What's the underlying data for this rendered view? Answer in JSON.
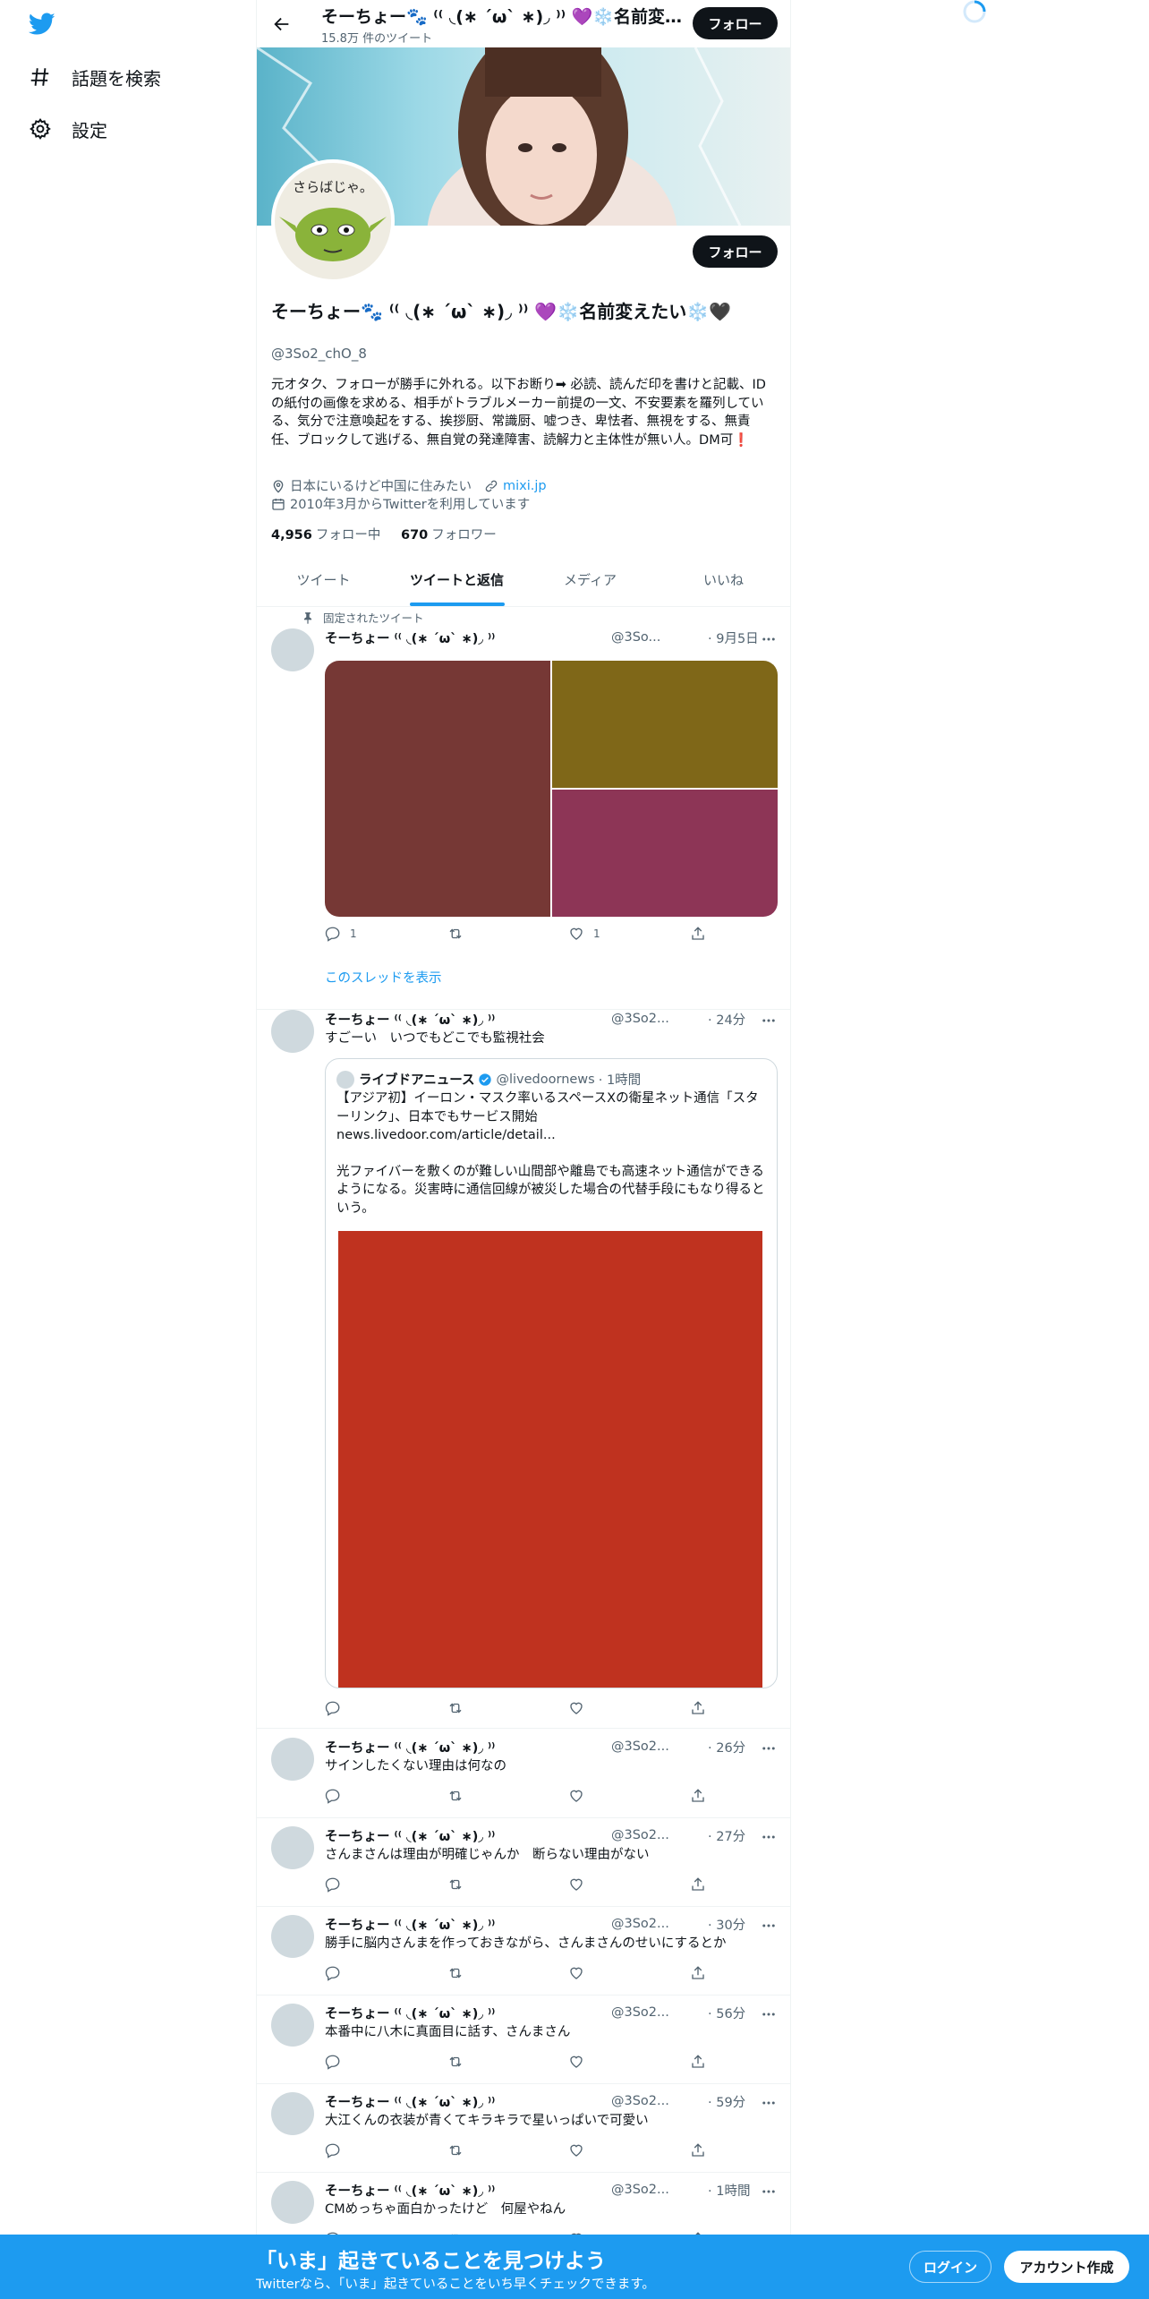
{
  "nav": {
    "items": [
      {
        "label": "話題を検索",
        "icon": "hashtag-icon"
      },
      {
        "label": "設定",
        "icon": "gear-icon"
      }
    ]
  },
  "header": {
    "name": "そーちょー🐾 ⁽⁽ ◟(∗ ˊωˋ ∗)◞ ⁾⁾ 💜❄️名前変えたい❄️🖤",
    "tweet_count": "15.8万 件のツイート",
    "follow_label": "フォロー"
  },
  "profile": {
    "name": "そーちょー🐾 ⁽⁽ ◟(∗ ˊωˋ ∗)◞ ⁾⁾ 💜❄️名前変えたい❄️🖤",
    "handle": "@3So2_chO_8",
    "follow_label": "フォロー",
    "avatar_text": "さらばじゃ。",
    "bio": "元オタク、フォローが勝手に外れる。以下お断り➡ 必読、読んだ印を書けと記載、IDの紙付の画像を求める、相手がトラブルメーカー前提の一文、不安要素を羅列している、気分で注意喚起をする、挨拶厨、常識厨、嘘つき、卑怯者、無視をする、無責任、ブロックして逃げる、無自覚の発達障害、読解力と主体性が無い人。DM可❗",
    "location": "日本にいるけど中国に住みたい",
    "link": "mixi.jp",
    "joined": "2010年3月からTwitterを利用しています",
    "following_count": "4,956",
    "following_label": "フォロー中",
    "followers_count": "670",
    "followers_label": "フォロワー"
  },
  "tabs": [
    {
      "label": "ツイート",
      "active": false
    },
    {
      "label": "ツイートと返信",
      "active": true
    },
    {
      "label": "メディア",
      "active": false
    },
    {
      "label": "いいね",
      "active": false
    }
  ],
  "pinned_label": "固定されたツイート",
  "show_thread": "このスレッドを表示",
  "tweets": [
    {
      "name": "そーちょー ⁽⁽ ◟(∗ ˊωˋ ∗)◞ ⁾⁾",
      "handle": "@3So...",
      "time": "· 9月5日",
      "text": "",
      "reply_count": "1",
      "like_count": "1",
      "media_colors": [
        "#763835",
        "#7f6718",
        "#8d3556"
      ]
    },
    {
      "name": "そーちょー ⁽⁽ ◟(∗ ˊωˋ ∗)◞ ⁾⁾",
      "handle": "@3So2...",
      "time": "· 24分",
      "text": "すごーい　いつでもどこでも監視社会"
    },
    {
      "name": "そーちょー ⁽⁽ ◟(∗ ˊωˋ ∗)◞ ⁾⁾",
      "handle": "@3So2...",
      "time": "· 26分",
      "text": "サインしたくない理由は何なの"
    },
    {
      "name": "そーちょー ⁽⁽ ◟(∗ ˊωˋ ∗)◞ ⁾⁾",
      "handle": "@3So2...",
      "time": "· 27分",
      "text": "さんまさんは理由が明確じゃんか　断らない理由がない"
    },
    {
      "name": "そーちょー ⁽⁽ ◟(∗ ˊωˋ ∗)◞ ⁾⁾",
      "handle": "@3So2...",
      "time": "· 30分",
      "text": "勝手に脳内さんまを作っておきながら、さんまさんのせいにするとか"
    },
    {
      "name": "そーちょー ⁽⁽ ◟(∗ ˊωˋ ∗)◞ ⁾⁾",
      "handle": "@3So2...",
      "time": "· 56分",
      "text": "本番中に八木に真面目に話す、さんまさん"
    },
    {
      "name": "そーちょー ⁽⁽ ◟(∗ ˊωˋ ∗)◞ ⁾⁾",
      "handle": "@3So2...",
      "time": "· 59分",
      "text": "大江くんの衣装が青くてキラキラで星いっぱいで可愛い"
    },
    {
      "name": "そーちょー ⁽⁽ ◟(∗ ˊωˋ ∗)◞ ⁾⁾",
      "handle": "@3So2...",
      "time": "· 1時間",
      "text": "CMめっちゃ面白かったけど　何屋やねん"
    }
  ],
  "quote": {
    "name": "ライブドアニュース",
    "handle": "@livedoornews",
    "time": "· 1時間",
    "line1": "【アジア初】イーロン・マスク率いるスペースXの衛星ネット通信「スターリンク」、日本でもサービス開始",
    "line2": "news.livedoor.com/article/detail...",
    "line3": "光ファイバーを敷くのが難しい山間部や離島でも高速ネット通信ができるようになる。災害時に通信回線が被災した場合の代替手段にもなり得るという。",
    "image_color": "#bf321f"
  },
  "bottom_banner": {
    "title": "「いま」起きていることを見つけよう",
    "subtitle": "Twitterなら、「いま」起きていることをいち早くチェックできます。",
    "login": "ログイン",
    "signup": "アカウント作成"
  },
  "colors": {
    "accent": "#1d9bf0",
    "text": "#0f1419",
    "muted": "#536471"
  }
}
